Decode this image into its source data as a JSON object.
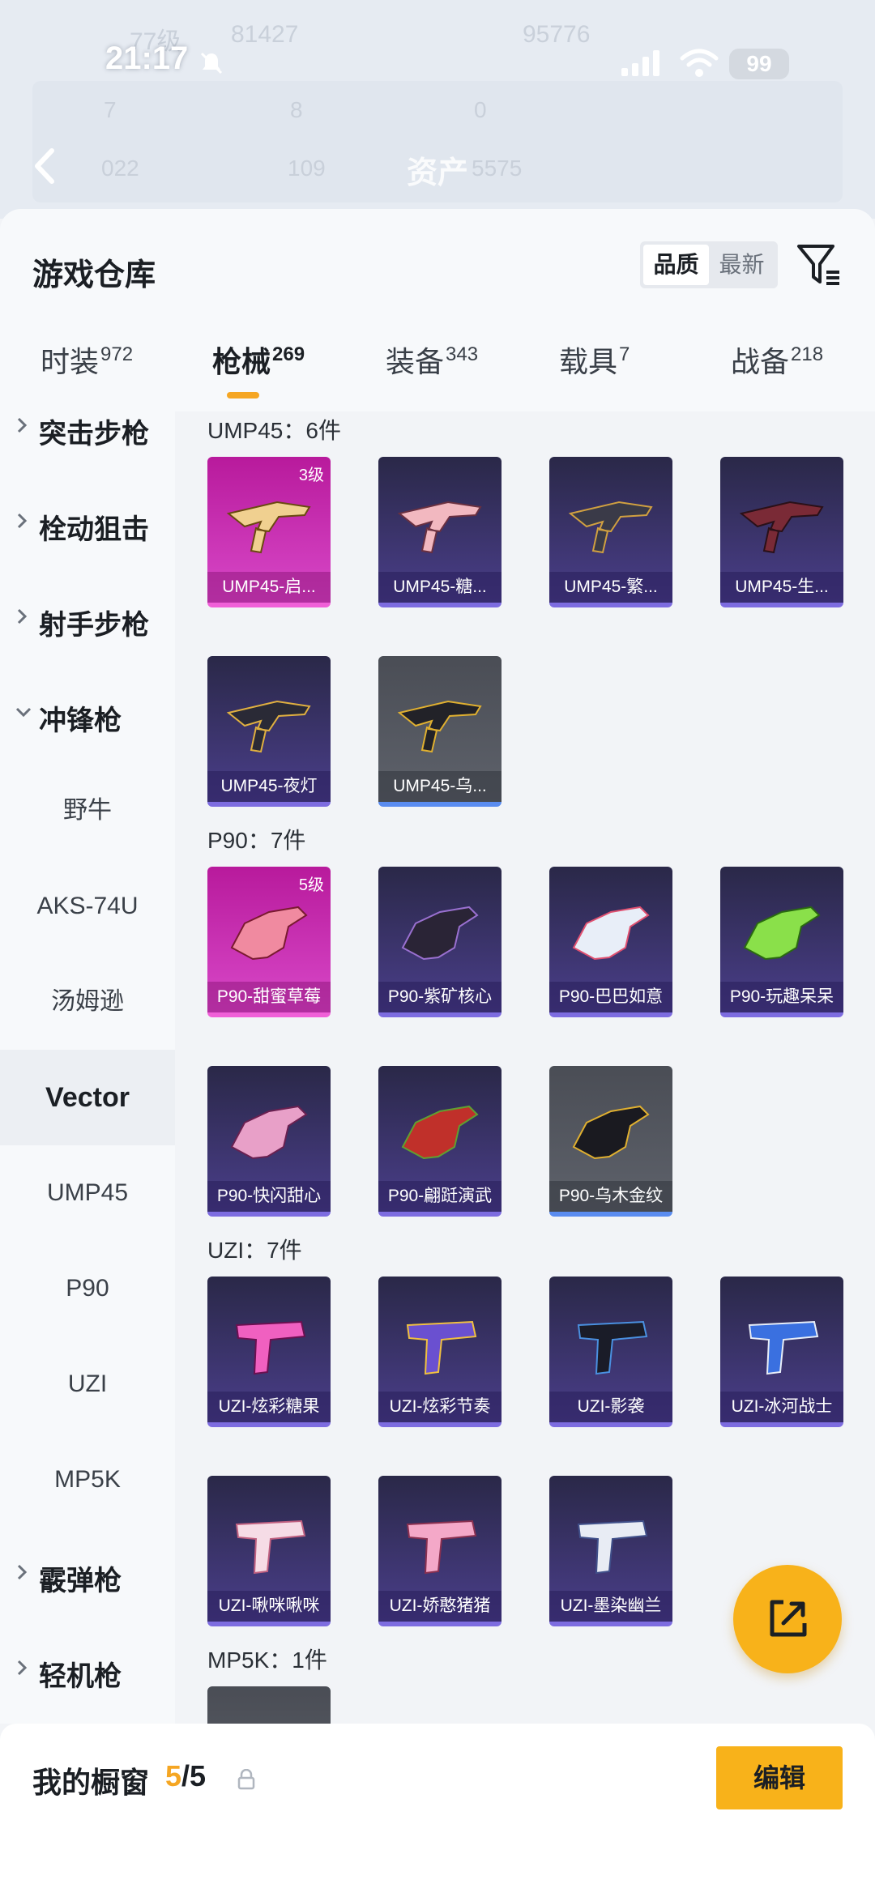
{
  "status_bar": {
    "time": "21:17",
    "battery": "99"
  },
  "header_ghost": {
    "level": "77级",
    "score": "81427",
    "score2": "95776",
    "stat1": "7",
    "stat2": "8",
    "stat3": "0",
    "stat4": "022",
    "stat5": "109",
    "asset_label": "资产",
    "asset_value": "5575"
  },
  "page": {
    "title": "游戏仓库"
  },
  "sort": {
    "options": [
      "品质",
      "最新"
    ],
    "selected": "品质"
  },
  "tabs": [
    {
      "label": "时装",
      "count": "972"
    },
    {
      "label": "枪械",
      "count": "269"
    },
    {
      "label": "装备",
      "count": "343"
    },
    {
      "label": "载具",
      "count": "7"
    },
    {
      "label": "战备",
      "count": "218"
    }
  ],
  "sidebar": {
    "categories": [
      "突击步枪",
      "栓动狙击",
      "射手步枪",
      "冲锋枪",
      "霰弹枪",
      "轻机枪"
    ],
    "subitems": [
      "野牛",
      "AKS-74U",
      "汤姆逊",
      "Vector",
      "UMP45",
      "P90",
      "UZI",
      "MP5K"
    ],
    "active_sub": "Vector"
  },
  "sections": [
    {
      "title": "UMP45：6件",
      "items": [
        {
          "name": "UMP45-启...",
          "level": "3级",
          "rarity": "gold"
        },
        {
          "name": "UMP45-糖...",
          "rarity": "purple"
        },
        {
          "name": "UMP45-繁...",
          "rarity": "purple"
        },
        {
          "name": "UMP45-生...",
          "rarity": "purple"
        },
        {
          "name": "UMP45-夜灯",
          "rarity": "purple"
        },
        {
          "name": "UMP45-乌...",
          "rarity": "grey"
        }
      ]
    },
    {
      "title": "P90：7件",
      "items": [
        {
          "name": "P90-甜蜜草莓",
          "level": "5级",
          "rarity": "gold"
        },
        {
          "name": "P90-紫矿核心",
          "rarity": "purple"
        },
        {
          "name": "P90-巴巴如意",
          "rarity": "purple"
        },
        {
          "name": "P90-玩趣呆呆",
          "rarity": "purple"
        },
        {
          "name": "P90-快闪甜心",
          "rarity": "purple"
        },
        {
          "name": "P90-翩跹演武",
          "rarity": "purple"
        },
        {
          "name": "P90-乌木金纹",
          "rarity": "grey"
        }
      ]
    },
    {
      "title": "UZI：7件",
      "items": [
        {
          "name": "UZI-炫彩糖果",
          "rarity": "purple"
        },
        {
          "name": "UZI-炫彩节奏",
          "rarity": "purple"
        },
        {
          "name": "UZI-影袭",
          "rarity": "purple"
        },
        {
          "name": "UZI-冰河战士",
          "rarity": "purple"
        },
        {
          "name": "UZI-啾咪啾咪",
          "rarity": "purple"
        },
        {
          "name": "UZI-娇憨猪猪",
          "rarity": "purple"
        },
        {
          "name": "UZI-墨染幽兰",
          "rarity": "purple"
        }
      ]
    },
    {
      "title": "MP5K：1件",
      "items": [
        {
          "name": "",
          "rarity": "grey"
        }
      ]
    }
  ],
  "showcase": {
    "title": "我的橱窗",
    "current": "5",
    "total": "/5",
    "edit_label": "编辑"
  },
  "colors": {
    "accent": "#f8b21a",
    "gold_card": "#c02aa8",
    "purple_card": "#3c3470",
    "grey_card": "#555861"
  }
}
